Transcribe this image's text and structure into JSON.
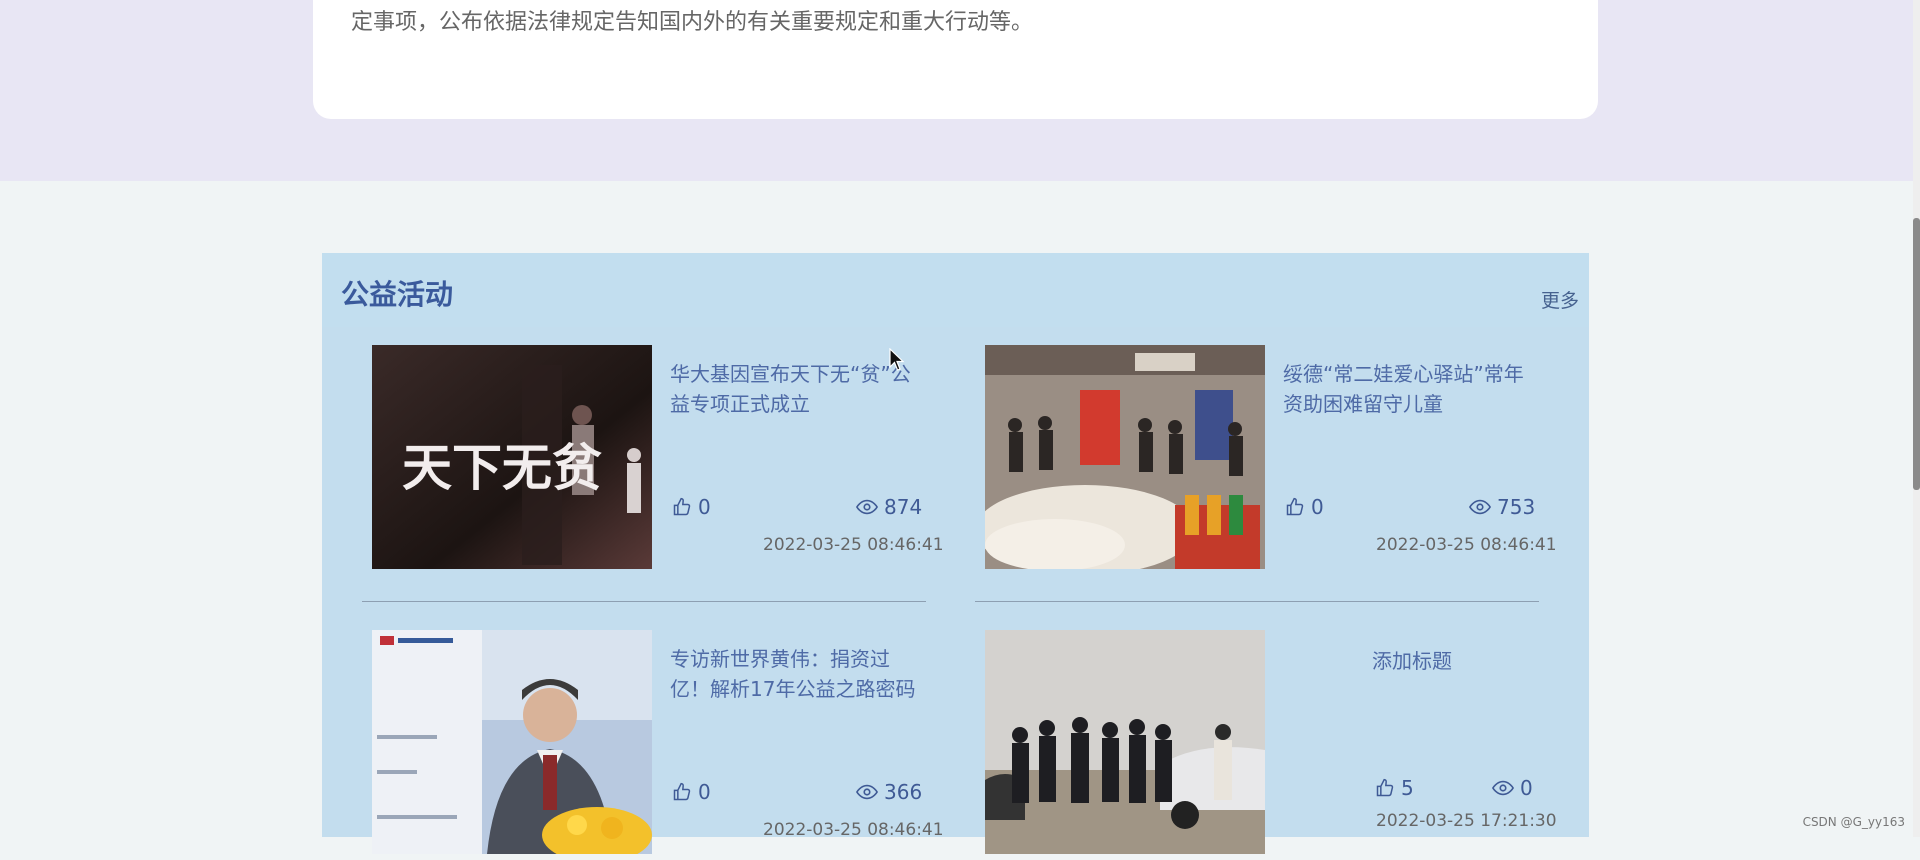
{
  "top_card": {
    "text": "定事项，公布依据法律规定告知国内外的有关重要规定和重大行动等。"
  },
  "section": {
    "title": "公益活动",
    "more_label": "更多"
  },
  "cards": [
    {
      "title": "华大基因宣布天下无“贫”公益专项正式成立",
      "likes": "0",
      "views": "874",
      "date": "2022-03-25 08:46:41",
      "thumb_text": "天下无贫"
    },
    {
      "title": "绥德“常二娃爱心驿站”常年资助困难留守儿童",
      "likes": "0",
      "views": "753",
      "date": "2022-03-25 08:46:41"
    },
    {
      "title": "专访新世界黄伟：捐资过亿！解析17年公益之路密码",
      "likes": "0",
      "views": "366",
      "date": "2022-03-25 08:46:41"
    },
    {
      "title": "添加标题",
      "likes": "5",
      "views": "0",
      "date": "2022-03-25 17:21:30"
    }
  ],
  "watermark": "CSDN @G_yy163",
  "icons": {
    "like": "thumbs-up-icon",
    "view": "eye-icon"
  },
  "colors": {
    "accent": "#3a5a9c",
    "section_bg": "#c3ddee",
    "top_band": "#e8e6f4"
  }
}
